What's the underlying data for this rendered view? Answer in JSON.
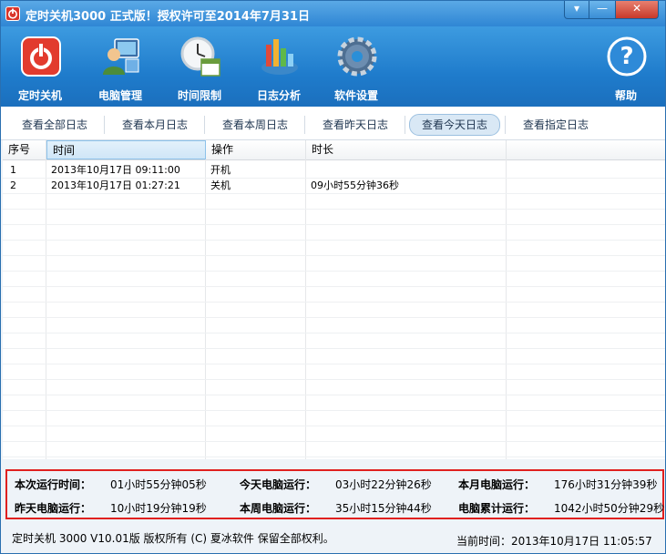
{
  "window": {
    "title": "定时关机3000 正式版！授权许可至2014年7月31日",
    "menu_glyph": "▾",
    "minimize_glyph": "—",
    "close_glyph": "✕"
  },
  "toolbar": {
    "items": [
      {
        "label": "定时关机",
        "icon": "power-icon"
      },
      {
        "label": "电脑管理",
        "icon": "computer-user-icon"
      },
      {
        "label": "时间限制",
        "icon": "clock-calendar-icon"
      },
      {
        "label": "日志分析",
        "icon": "chart-icon"
      },
      {
        "label": "软件设置",
        "icon": "gear-icon"
      }
    ],
    "help": {
      "label": "帮助",
      "icon": "help-icon",
      "glyph": "?"
    }
  },
  "tabs": [
    {
      "label": "查看全部日志",
      "active": false
    },
    {
      "label": "查看本月日志",
      "active": false
    },
    {
      "label": "查看本周日志",
      "active": false
    },
    {
      "label": "查看昨天日志",
      "active": false
    },
    {
      "label": "查看今天日志",
      "active": true
    },
    {
      "label": "查看指定日志",
      "active": false
    }
  ],
  "table": {
    "columns": [
      "序号",
      "时间",
      "操作",
      "时长"
    ],
    "rows": [
      {
        "no": "1",
        "time": "2013年10月17日 09:11:00",
        "op": "开机",
        "dur": ""
      },
      {
        "no": "2",
        "time": "2013年10月17日 01:27:21",
        "op": "关机",
        "dur": "09小时55分钟36秒"
      }
    ]
  },
  "stats": {
    "this_run": {
      "label": "本次运行时间：",
      "value": "01小时55分钟05秒"
    },
    "today": {
      "label": "今天电脑运行：",
      "value": "03小时22分钟26秒"
    },
    "month": {
      "label": "本月电脑运行：",
      "value": "176小时31分钟39秒"
    },
    "yesterday": {
      "label": "昨天电脑运行：",
      "value": "10小时19分钟19秒"
    },
    "week": {
      "label": "本周电脑运行：",
      "value": "35小时15分钟44秒"
    },
    "total": {
      "label": "电脑累计运行：",
      "value": "1042小时50分钟29秒"
    }
  },
  "status": {
    "copyright": "定时关机 3000 V10.01版  版权所有 (C)  夏冰软件 保留全部权利。",
    "current_time": "当前时间：2013年10月17日  11:05:57"
  },
  "colors": {
    "accent": "#1f7ccc",
    "highlight_border": "#e0201f",
    "power_red": "#d9352b"
  }
}
